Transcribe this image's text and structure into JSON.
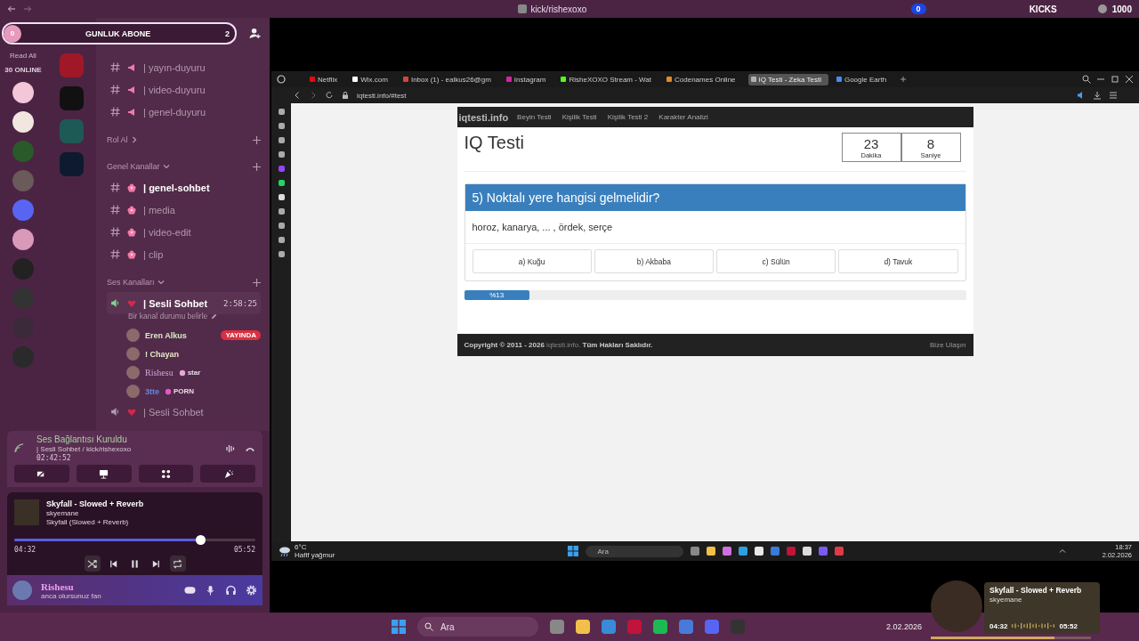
{
  "top_bar": {
    "title": "kick/rishexoxo",
    "badge": "0",
    "kicks_label": "KICKS",
    "kicks_count": "1000"
  },
  "overlay_pill": {
    "left_count": "0",
    "label": "GUNLUK ABONE",
    "right_count": "2"
  },
  "sidebar": {
    "read_all": "Read All",
    "online": "30 ONLINE"
  },
  "channel_list": {
    "sections": [
      {
        "channels": [
          {
            "kind": "announcement",
            "name": "| yayın-duyuru",
            "selected": false
          },
          {
            "kind": "announcement",
            "name": "| video-duyuru",
            "selected": false
          },
          {
            "kind": "announcement",
            "name": "| genel-duyuru",
            "selected": false
          }
        ]
      },
      {
        "title": "Rol Al",
        "collapsed": true
      },
      {
        "title": "Genel Kanallar",
        "collapsed": false,
        "channels": [
          {
            "kind": "text",
            "name": "| genel-sohbet",
            "selected": true
          },
          {
            "kind": "text",
            "name": "| media",
            "selected": false
          },
          {
            "kind": "text",
            "name": "| video-edit",
            "selected": false
          },
          {
            "kind": "text",
            "name": "| clip",
            "selected": false
          }
        ]
      },
      {
        "title": "Ses Kanalları",
        "collapsed": false,
        "channels": [
          {
            "kind": "voice",
            "name": "| Sesli Sohbet",
            "selected": true,
            "timer": "2:58:25",
            "status": "Bir kanal durumu belirle",
            "members": [
              {
                "name": "Eren Alkus",
                "color": "#d8ecc4",
                "badge": "YAYINDA"
              },
              {
                "name": "! Chayan",
                "color": "#e4efc8"
              },
              {
                "name": "Rishesu",
                "color": "#c8a8d8",
                "tag": "star"
              },
              {
                "name": "3tte",
                "color": "#6a86e0",
                "tag": "PORN"
              }
            ]
          },
          {
            "kind": "voice",
            "name": "| Sesli Sohbet",
            "selected": false
          }
        ]
      }
    ]
  },
  "voice_panel": {
    "status": "Ses Bağlantısı Kuruldu",
    "channel": "| Sesli Sohbet / kick/rishexoxo",
    "elapsed": "02:42:52"
  },
  "music": {
    "title": "Skyfall - Slowed + Reverb",
    "artist": "skyemane",
    "album": "Skyfall (Slowed + Reverb)",
    "level": 0.77,
    "elapsed": "04:32",
    "total": "05:52"
  },
  "user": {
    "name": "Rishesu",
    "status": "anca olursunuz fan"
  },
  "browser": {
    "tabs": [
      {
        "label": "Netflix",
        "selected": false,
        "color": "#e50914"
      },
      {
        "label": "Wix.com",
        "selected": false,
        "color": "#ffffff"
      },
      {
        "label": "Inbox (1) - ealkus26@gm",
        "selected": false,
        "color": "#d44638"
      },
      {
        "label": "Instagram",
        "selected": false,
        "color": "#d6249f"
      },
      {
        "label": "RisheXOXO Stream - Wat",
        "selected": false,
        "color": "#53fc18"
      },
      {
        "label": "Codenames Online",
        "selected": false,
        "color": "#e08a2c"
      },
      {
        "label": "IQ Testi - Zeka Testi",
        "selected": true,
        "color": "#b0b0b0"
      },
      {
        "label": "Google Earth",
        "selected": false,
        "color": "#4a8af4"
      }
    ],
    "url": "iqtesti.info/#test"
  },
  "site": {
    "brand": "iqtesti.info",
    "nav": [
      "Beyin Testi",
      "Kişilik Testi",
      "Kişilik Testi 2",
      "Karakter Analizi"
    ],
    "heading": "IQ Testi",
    "timer": [
      {
        "value": "23",
        "label": "Dakika"
      },
      {
        "value": "8",
        "label": "Saniye"
      }
    ],
    "question": "5) Noktalı yere hangisi gelmelidir?",
    "prompt": "horoz, kanarya, ... , ördek, serçe",
    "options": [
      "a) Kuğu",
      "b) Akbaba",
      "c) Sülün",
      "d) Tavuk"
    ],
    "progress": {
      "level": 0.13,
      "label": "%13"
    },
    "footer": {
      "copyright": "Copyright © 2011 - 2026",
      "site": "iqtesti.info.",
      "rights": "Tüm Hakları Saklıdır.",
      "contact": "Bize Ulaşın"
    }
  },
  "inner_taskbar": {
    "temperature": "6°C",
    "weather": "Hafif yağmur",
    "search_placeholder": "Ara",
    "time": "18:37",
    "date": "2.02.2026"
  },
  "taskbar": {
    "search_placeholder": "Ara",
    "date": "2.02.2026"
  },
  "media_widget": {
    "title": "Skyfall - Slowed + Reverb",
    "artist": "skyemane",
    "elapsed": "04:32",
    "total": "05:52",
    "level": 0.77
  }
}
